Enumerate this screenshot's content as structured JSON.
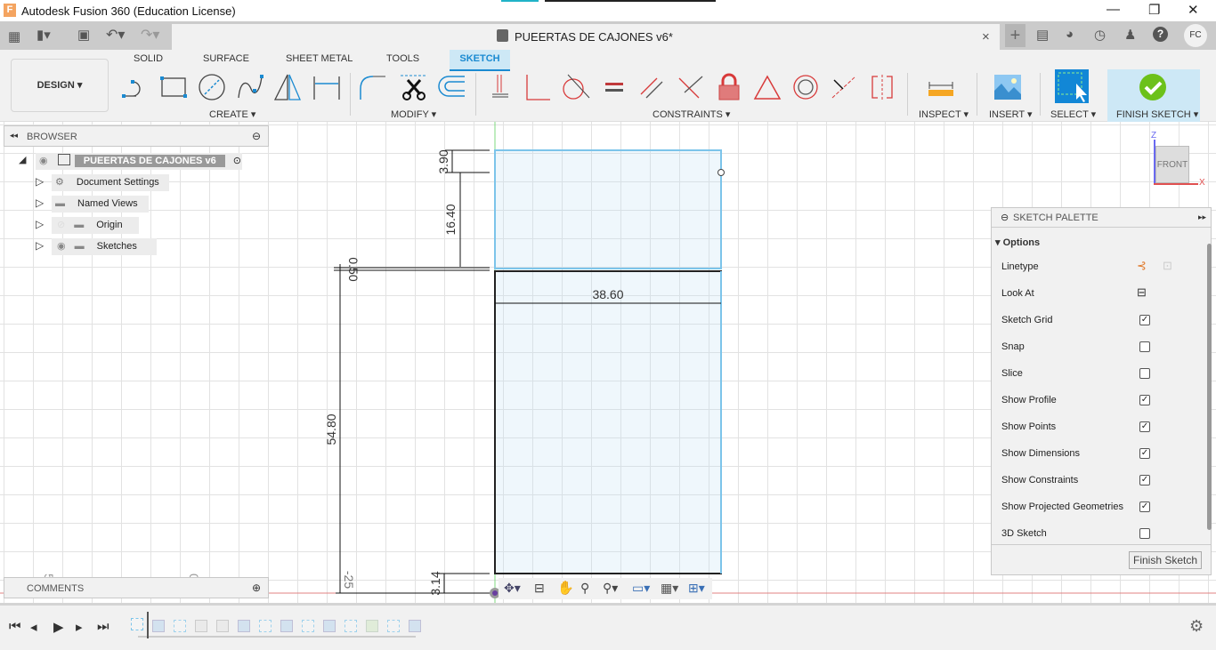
{
  "app": {
    "title": "Autodesk Fusion 360 (Education License)",
    "logo": "F"
  },
  "window_controls": {
    "minimize": "—",
    "maximize": "❐",
    "close": "✕"
  },
  "document": {
    "tab_title": "PUEERTAS DE CAJONES v6*",
    "close": "×",
    "new_tab": "+"
  },
  "user": {
    "initials": "FC"
  },
  "ribbon": {
    "workspace": "DESIGN ▾",
    "tabs": [
      {
        "label": "SOLID"
      },
      {
        "label": "SURFACE"
      },
      {
        "label": "SHEET METAL"
      },
      {
        "label": "TOOLS"
      },
      {
        "label": "SKETCH",
        "active": true
      }
    ],
    "groups": {
      "create": "CREATE ▾",
      "modify": "MODIFY ▾",
      "constraints": "CONSTRAINTS ▾",
      "inspect": "INSPECT ▾",
      "insert": "INSERT ▾",
      "select": "SELECT ▾",
      "finish": "FINISH SKETCH ▾"
    },
    "accent": "#1a8ad1",
    "finish_color": "#6cc11a",
    "constraint_color": "#d83a3a"
  },
  "browser": {
    "title": "BROWSER",
    "root": "PUEERTAS DE CAJONES v6",
    "items": [
      {
        "label": "Document Settings",
        "icon": "gear-icon"
      },
      {
        "label": "Named Views",
        "icon": "folder-icon"
      },
      {
        "label": "Origin",
        "icon": "folder-icon",
        "hidden": true
      },
      {
        "label": "Sketches",
        "icon": "folder-icon"
      }
    ]
  },
  "comments": {
    "title": "COMMENTS"
  },
  "viewcube": {
    "face": "FRONT",
    "z": "Z",
    "x": "X"
  },
  "sketch": {
    "dimensions": {
      "top_gap": "3.90",
      "upper_height": "16.40",
      "gap": "0.50",
      "width": "38.60",
      "lower_height": "54.80",
      "bottom_gap": "3.14",
      "offset": "-25"
    },
    "axis_labels": {
      "left": "5",
      "mid": "0"
    }
  },
  "palette": {
    "title": "SKETCH PALETTE",
    "section": "Options",
    "options": [
      {
        "label": "Linetype",
        "type": "icons"
      },
      {
        "label": "Look At",
        "type": "icon"
      },
      {
        "label": "Sketch Grid",
        "checked": true
      },
      {
        "label": "Snap",
        "checked": false
      },
      {
        "label": "Slice",
        "checked": false
      },
      {
        "label": "Show Profile",
        "checked": true
      },
      {
        "label": "Show Points",
        "checked": true
      },
      {
        "label": "Show Dimensions",
        "checked": true
      },
      {
        "label": "Show Constraints",
        "checked": true
      },
      {
        "label": "Show Projected Geometries",
        "checked": true
      },
      {
        "label": "3D Sketch",
        "checked": false
      }
    ],
    "finish_button": "Finish Sketch"
  },
  "timeline": {
    "items": [
      "sketch",
      "extrude",
      "sketch",
      "move",
      "move",
      "extrude",
      "sketch",
      "extrude",
      "sketch",
      "extrude",
      "sketch",
      "split",
      "sketch",
      "extrude"
    ]
  }
}
